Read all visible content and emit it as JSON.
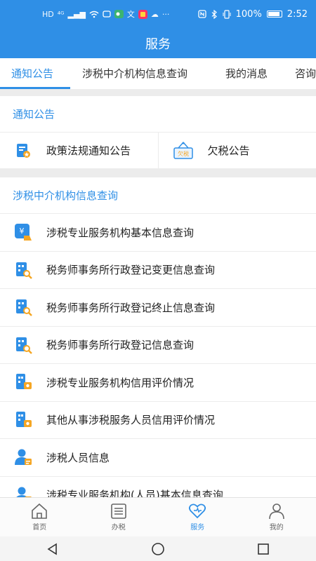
{
  "status": {
    "left_icons": [
      "HD",
      "⁴ᴳ",
      "▂▄▆",
      "wifi",
      "msg",
      "wechat",
      "文",
      "app",
      "☁",
      "···"
    ],
    "battery": "100%",
    "time": "2:52"
  },
  "header": {
    "title": "服务"
  },
  "tabs": [
    {
      "label": "通知公告",
      "active": true
    },
    {
      "label": "涉税中介机构信息查询",
      "active": false
    },
    {
      "label": "我的消息",
      "active": false
    },
    {
      "label": "咨询",
      "active": false
    }
  ],
  "notice_section": {
    "title": "通知公告",
    "items": [
      {
        "label": "政策法规通知公告",
        "icon": "document-star-icon"
      },
      {
        "label": "欠税公告",
        "icon": "tax-owed-sign-icon",
        "icon_text": "欠税"
      }
    ]
  },
  "agency_section": {
    "title": "涉税中介机构信息查询",
    "items": [
      {
        "label": "涉税专业服务机构基本信息查询",
        "icon": "yuan-agency-icon"
      },
      {
        "label": "税务师事务所行政登记变更信息查询",
        "icon": "building-search-icon"
      },
      {
        "label": "税务师事务所行政登记终止信息查询",
        "icon": "building-search-icon"
      },
      {
        "label": "税务师事务所行政登记信息查询",
        "icon": "building-search-icon"
      },
      {
        "label": "涉税专业服务机构信用评价情况",
        "icon": "building-badge-icon"
      },
      {
        "label": "其他从事涉税服务人员信用评价情况",
        "icon": "building-badge-icon"
      },
      {
        "label": "涉税人员信息",
        "icon": "person-card-icon"
      },
      {
        "label": "涉税专业服务机构(人员)基本信息查询",
        "icon": "person-card-icon"
      }
    ]
  },
  "bottom_nav": [
    {
      "label": "首页",
      "icon": "home-icon",
      "active": false
    },
    {
      "label": "办税",
      "icon": "list-icon",
      "active": false
    },
    {
      "label": "服务",
      "icon": "heart-icon",
      "active": true
    },
    {
      "label": "我的",
      "icon": "user-icon",
      "active": false
    }
  ],
  "colors": {
    "primary": "#2f8fe6",
    "accent_orange": "#f5a623",
    "divider": "#ececec"
  }
}
